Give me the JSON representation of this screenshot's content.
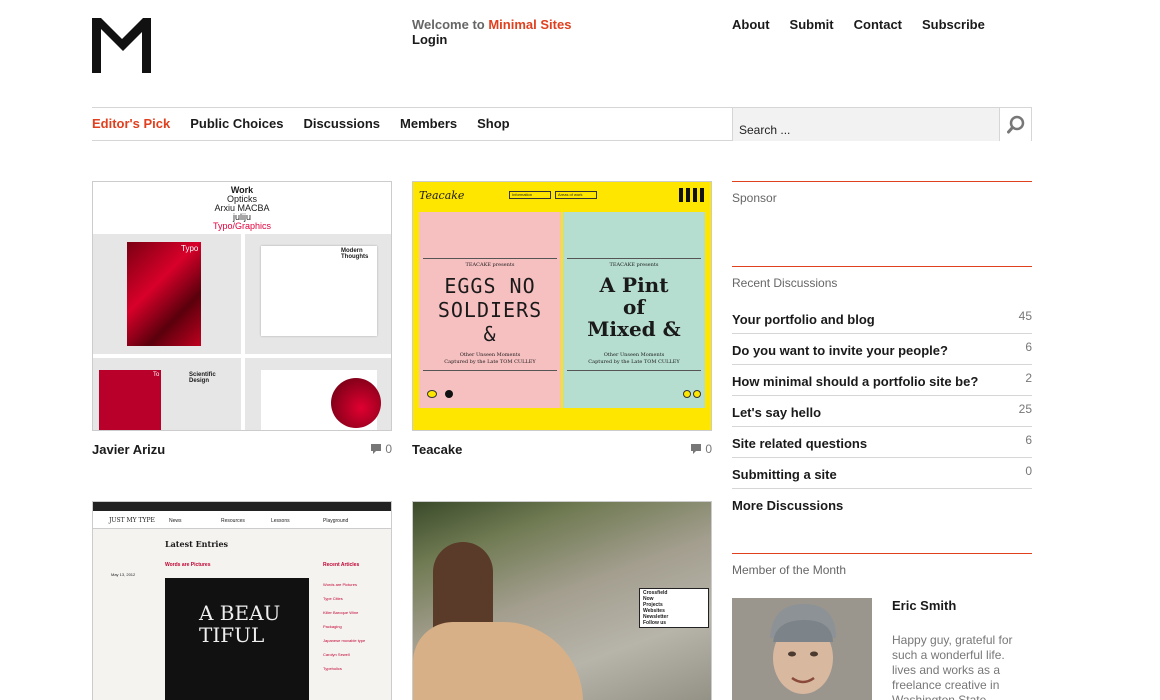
{
  "header": {
    "welcome_prefix": "Welcome to",
    "brand": "Minimal Sites",
    "login": "Login",
    "top_nav": [
      "About",
      "Submit",
      "Contact",
      "Subscribe"
    ]
  },
  "nav": {
    "items": [
      "Editor's Pick",
      "Public Choices",
      "Discussions",
      "Members",
      "Shop"
    ],
    "active_index": 0
  },
  "search": {
    "placeholder": "Search ..."
  },
  "cards": [
    {
      "title": "Javier Arizu",
      "comments": "0",
      "thumb_lines": [
        "Work",
        "Opticks",
        "Arxiu MACBA",
        "juliju",
        "Typo/Graphics"
      ],
      "thumb_labels": [
        "Typo",
        "Modern Thoughts",
        "To",
        "Scientific Design"
      ]
    },
    {
      "title": "Teacake",
      "comments": "0",
      "thumb_brand": "Teacake",
      "thumb_menu": [
        "Information",
        "Areas of work"
      ],
      "thumb_panels": [
        {
          "kicker": "TEACAKE presents",
          "headline": "EGGS NO SOLDIERS &",
          "sub": "Other Unseen Moments",
          "credit": "Captured by the Late TOM CULLEY"
        },
        {
          "kicker": "TEACAKE presents",
          "headline": "A Pint of Mixed &",
          "sub": "Other Unseen Moments",
          "credit": "Captured by the Late TOM CULLEY"
        }
      ]
    },
    {
      "title": "",
      "comments": "",
      "thumb_brand": "JUST MY TYPE",
      "thumb_nav": [
        "News",
        "Resources",
        "Lessons",
        "Playground"
      ],
      "thumb_heading": "Latest Entries",
      "thumb_post_title": "Words are Pictures",
      "thumb_post_date": "May 13, 2012",
      "thumb_sidebar_title": "Recent Articles",
      "thumb_sidebar_items": [
        "Words are Pictures",
        "Type Cities",
        "Killer Baroque Wine Packaging",
        "Japanese movable type",
        "Carolyn Sewell",
        "Typeholics"
      ],
      "thumb_art_text": "A BEAU TIFUL"
    },
    {
      "title": "",
      "comments": "",
      "thumb_menu": [
        "Crossfield",
        "Now",
        "Projects",
        "Websites",
        "Newsletter",
        "Follow us"
      ]
    }
  ],
  "sidebar": {
    "sponsor_title": "Sponsor",
    "discussions_title": "Recent Discussions",
    "discussions": [
      {
        "title": "Your portfolio and blog",
        "count": "45"
      },
      {
        "title": "Do you want to invite your people?",
        "count": "6"
      },
      {
        "title": "How minimal should a portfolio site be?",
        "count": "2"
      },
      {
        "title": "Let's say hello",
        "count": "25"
      },
      {
        "title": "Site related questions",
        "count": "6"
      },
      {
        "title": "Submitting a site",
        "count": "0"
      }
    ],
    "more": "More Discussions",
    "member_title": "Member of the Month",
    "member_name": "Eric Smith",
    "member_bio": "Happy guy, grateful for such a wonderful life. lives and works as a freelance creative in Washington State."
  },
  "colors": {
    "accent": "#e0401e",
    "text": "#1a1a1a",
    "muted": "#777777",
    "rule": "#d6d6d6"
  },
  "icons": {
    "search": "search-icon",
    "comment": "comment-icon",
    "logo": "logo-icon"
  }
}
